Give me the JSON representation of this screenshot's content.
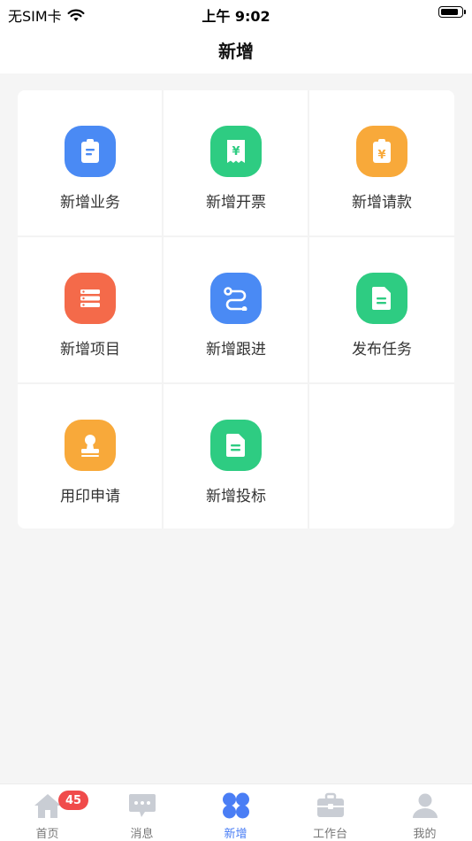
{
  "status_bar": {
    "carrier": "无SIM卡",
    "time": "上午 9:02"
  },
  "nav": {
    "title": "新增"
  },
  "grid": [
    {
      "label": "新增业务",
      "icon": "clipboard-icon",
      "color": "#4a8af4"
    },
    {
      "label": "新增开票",
      "icon": "receipt-yuan-icon",
      "color": "#2ecc82"
    },
    {
      "label": "新增请款",
      "icon": "clipboard-yuan-icon",
      "color": "#f8a93a"
    },
    {
      "label": "新增项目",
      "icon": "list-icon",
      "color": "#f46a4a"
    },
    {
      "label": "新增跟进",
      "icon": "route-icon",
      "color": "#4a8af4"
    },
    {
      "label": "发布任务",
      "icon": "document-icon",
      "color": "#2ecc82"
    },
    {
      "label": "用印申请",
      "icon": "stamp-icon",
      "color": "#f8a93a"
    },
    {
      "label": "新增投标",
      "icon": "document-icon",
      "color": "#2ecc82"
    }
  ],
  "tabbar": {
    "tabs": [
      {
        "label": "首页",
        "icon": "home-icon"
      },
      {
        "label": "消息",
        "icon": "message-icon",
        "badge": "45"
      },
      {
        "label": "新增",
        "icon": "add-grid-icon",
        "active": true
      },
      {
        "label": "工作台",
        "icon": "briefcase-icon"
      },
      {
        "label": "我的",
        "icon": "user-icon"
      }
    ],
    "active_color": "#4a7ef5",
    "inactive_color": "#c9cdd4"
  }
}
